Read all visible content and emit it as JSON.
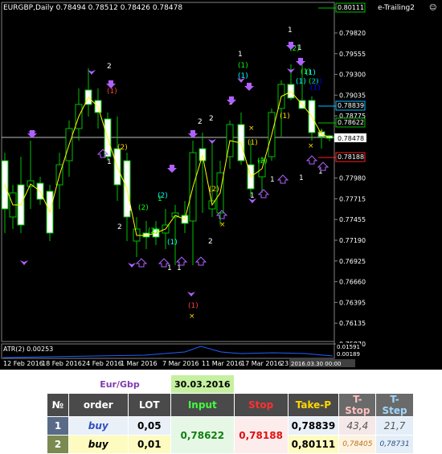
{
  "chart": {
    "title": "EURGBP,Daily  0.78494 0.78512 0.78426 0.78478",
    "indicator_name": "e-Trailing2",
    "price_labels": [
      "0.79820",
      "0.79555",
      "0.79300",
      "0.79035",
      "0.78775",
      "0.78510",
      "0.78250",
      "0.77980",
      "0.77715",
      "0.77455",
      "0.77190",
      "0.76925",
      "0.76660",
      "0.76395",
      "0.76135",
      "0.75870"
    ],
    "date_labels": [
      "12 Feb 2016",
      "18 Feb 2016",
      "24 Feb 2016",
      "1 Mar 2016",
      "7 Mar 2016",
      "11 Mar 2016",
      "17 Mar 2016",
      "23 Mar 2016"
    ],
    "date_cursor": "2016.03.30 00:00",
    "current_price": "0.78478",
    "level_labels": [
      {
        "text": "0.80111",
        "color": "#00c000"
      },
      {
        "text": "0.78839",
        "color": "#00c0ff"
      },
      {
        "text": "0.78622",
        "color": "#00c000"
      },
      {
        "text": "0.78188",
        "color": "#ff2020"
      }
    ],
    "atr_label": "ATR(2) 0.00253",
    "atr_levels": [
      "0.01591",
      "0.00189"
    ],
    "markers": [
      "2",
      "(1)",
      "1",
      "(2)",
      "2",
      "1",
      "(2)",
      "(2)",
      "1",
      "(2)",
      "(1)",
      "1",
      "2",
      "1",
      "(1)",
      "2",
      "(2)",
      "2",
      "1",
      "1",
      "(1)",
      "(1)",
      "1",
      "(1)",
      "(2)",
      "1",
      "(1)",
      "(2)",
      "(1)",
      "1",
      "(2)",
      "1",
      "1",
      "(1)",
      "(1)",
      "(1)",
      "(1)",
      "1",
      "1"
    ]
  },
  "positions": {
    "symbol": "Eur/Gbp",
    "date": "30.03.2016",
    "headers": {
      "no": "№",
      "order": "order",
      "lot": "LOT",
      "input": "Input",
      "stop": "Stop",
      "take": "Take-P",
      "tstop": "T-Stop",
      "tstep": "T-Step"
    },
    "rows": [
      {
        "no": "1",
        "order": "buy",
        "lot": "0,05",
        "take": "0,78839",
        "tstop": "43,4",
        "tstep": "21,7"
      },
      {
        "no": "2",
        "order": "buy",
        "lot": "0,01",
        "take": "0,80111",
        "tstop": "0,78405",
        "tstep": "0,78731"
      }
    ],
    "input": "0,78622",
    "stop": "0,78188"
  }
}
